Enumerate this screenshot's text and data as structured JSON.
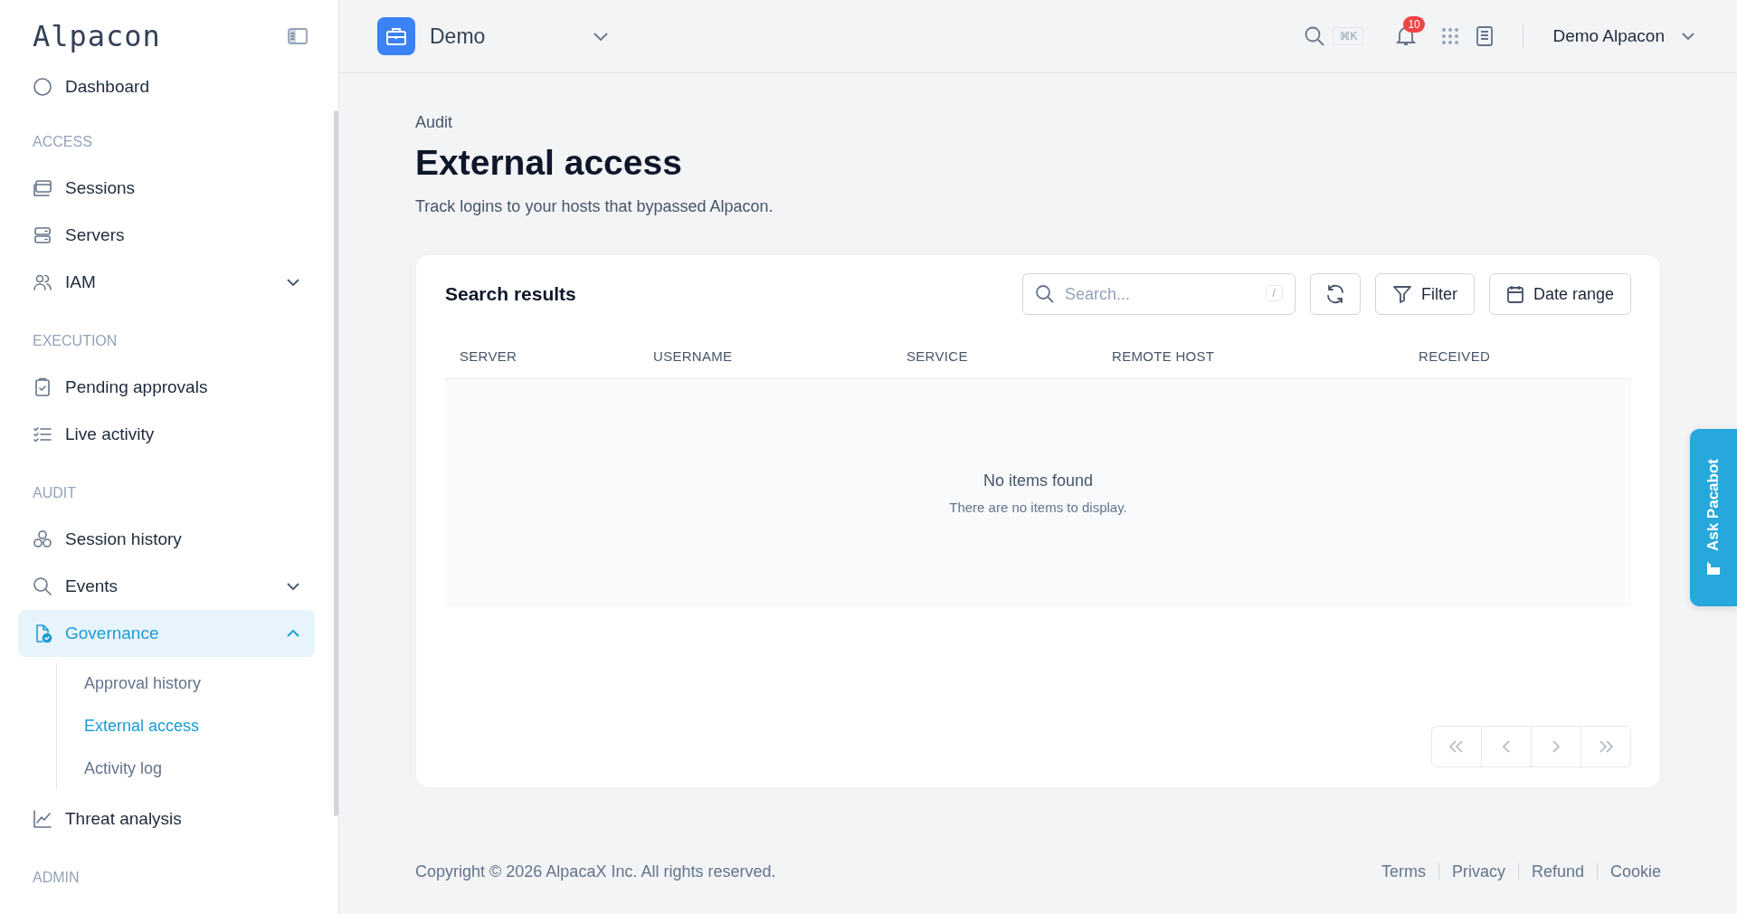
{
  "sidebar": {
    "logo": "Alpacon",
    "partial_item": "Dashboard",
    "sections": [
      {
        "title": "ACCESS",
        "items": [
          {
            "label": "Sessions",
            "selected": false
          },
          {
            "label": "Servers",
            "selected": false
          },
          {
            "label": "IAM",
            "selected": false,
            "expanded": false
          }
        ]
      },
      {
        "title": "EXECUTION",
        "items": [
          {
            "label": "Pending approvals",
            "selected": false
          },
          {
            "label": "Live activity",
            "selected": false
          }
        ]
      },
      {
        "title": "AUDIT",
        "items": [
          {
            "label": "Session history",
            "selected": false
          },
          {
            "label": "Events",
            "selected": false,
            "expanded": false
          },
          {
            "label": "Governance",
            "selected": true,
            "expanded": true,
            "children": [
              {
                "label": "Approval history",
                "selected": false
              },
              {
                "label": "External access",
                "selected": true
              },
              {
                "label": "Activity log",
                "selected": false
              }
            ]
          },
          {
            "label": "Threat analysis",
            "selected": false
          }
        ]
      },
      {
        "title": "ADMIN"
      }
    ]
  },
  "header": {
    "workspace": "Demo",
    "shortcut": "⌘K",
    "notifications": "10",
    "user": "Demo Alpacon"
  },
  "page": {
    "breadcrumb": "Audit",
    "title": "External access",
    "subtitle": "Track logins to your hosts that bypassed Alpacon."
  },
  "results": {
    "title": "Search results",
    "search": {
      "placeholder": "Search...",
      "shortcut": "/"
    },
    "buttons": [
      "Filter",
      "Date range"
    ],
    "columns": [
      "SERVER",
      "USERNAME",
      "SERVICE",
      "REMOTE HOST",
      "RECEIVED"
    ],
    "empty_title": "No items found",
    "empty_text": "There are no items to display."
  },
  "footer": {
    "copyright": "Copyright © 2026 AlpacaX Inc. All rights reserved.",
    "links": [
      "Terms",
      "Privacy",
      "Refund",
      "Cookie"
    ]
  },
  "assistant": {
    "label": "Ask Pacabot"
  }
}
